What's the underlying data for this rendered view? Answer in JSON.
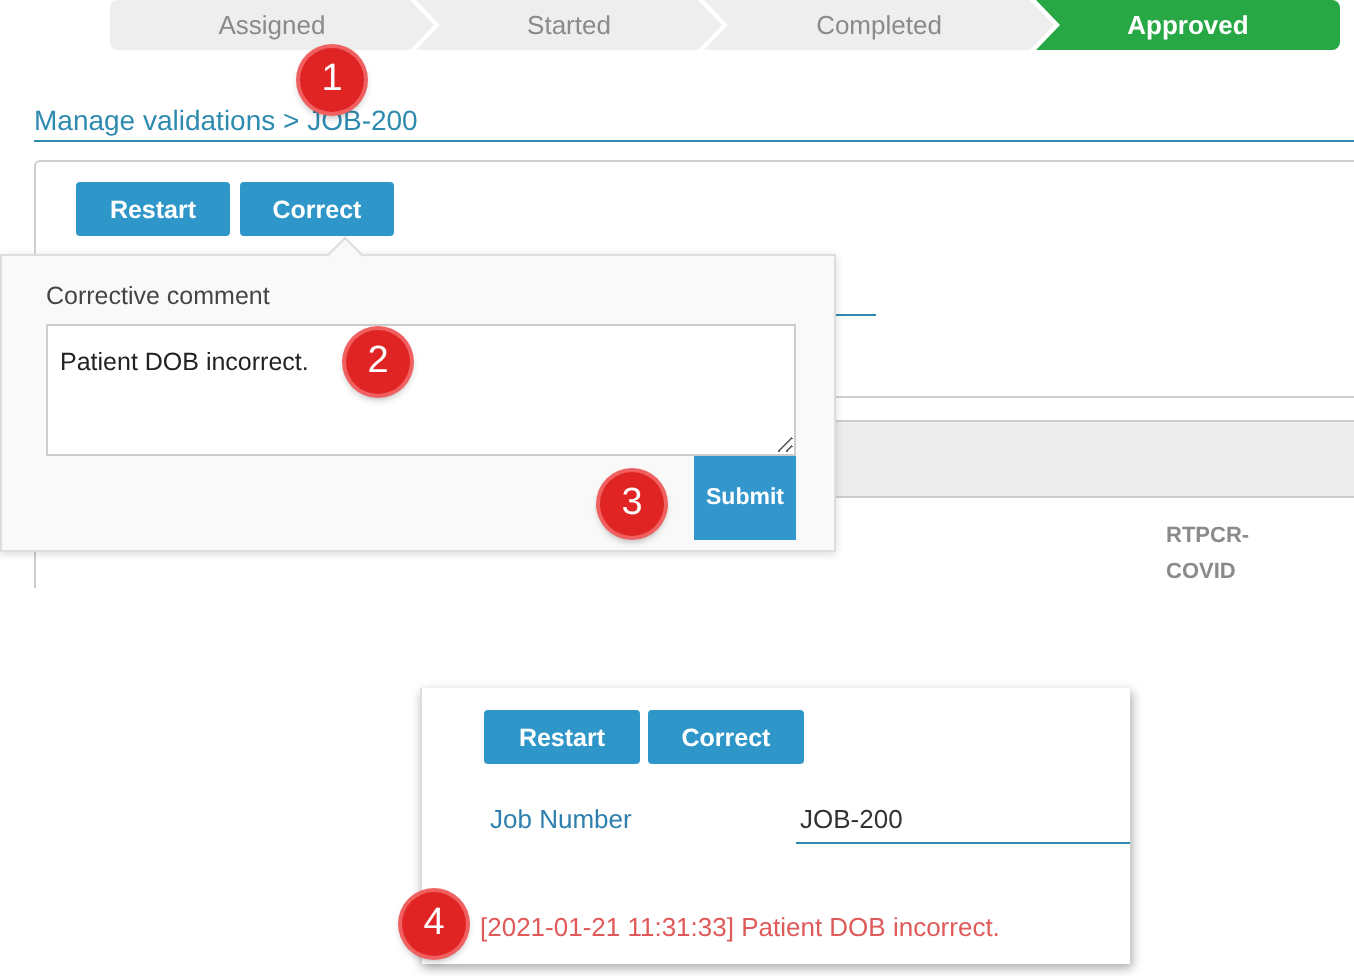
{
  "steps": [
    {
      "label": "Assigned",
      "selected": false
    },
    {
      "label": "Started",
      "selected": false
    },
    {
      "label": "Completed",
      "selected": false
    },
    {
      "label": "Approved",
      "selected": true
    }
  ],
  "header": {
    "title": "Manage validations > JOB-200"
  },
  "panel": {
    "buttons": [
      "Restart",
      "Correct"
    ],
    "cell": "RTPCR-COVID"
  },
  "popover": {
    "label": "Corrective comment",
    "value": "Patient DOB incorrect.",
    "submit": "Submit"
  },
  "result_panel": {
    "buttons": [
      "Restart",
      "Correct"
    ],
    "field_label": "Job Number",
    "field_value": "JOB-200",
    "log": "[2021-01-21 11:31:33] Patient DOB incorrect."
  },
  "markers": [
    "1",
    "2",
    "3",
    "4"
  ]
}
